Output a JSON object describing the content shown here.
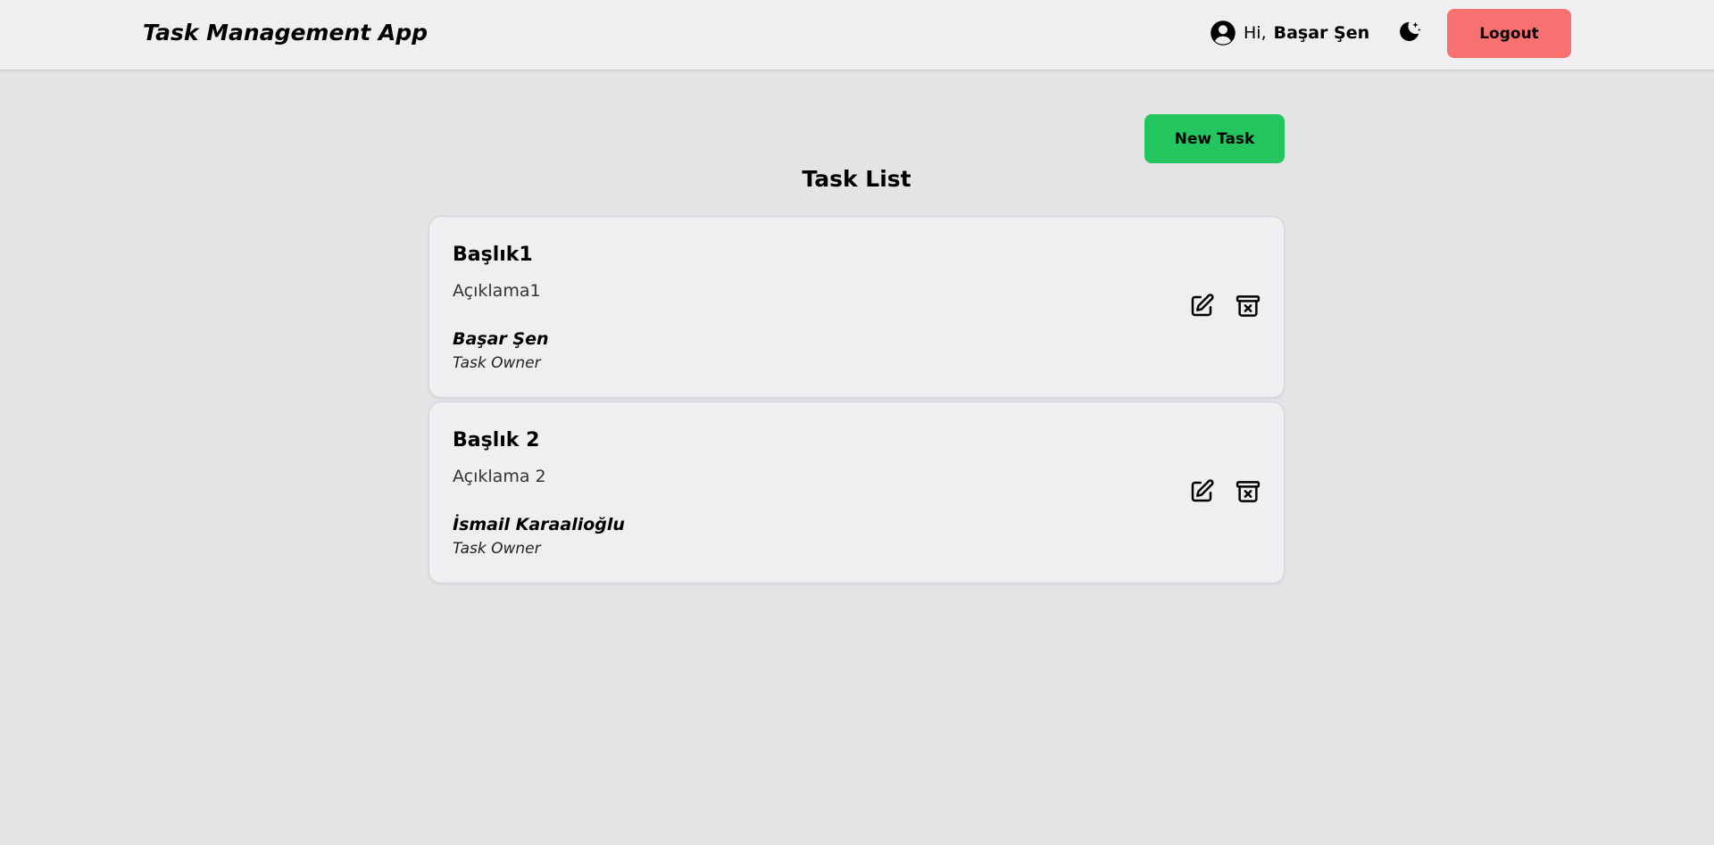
{
  "header": {
    "app_title": "Task Management App",
    "greeting_prefix": "Hi,",
    "user_name": "Başar Şen",
    "theme_toggle_icon": "moon-stars-icon",
    "logout_label": "Logout"
  },
  "main": {
    "new_task_label": "New Task",
    "page_title": "Task List",
    "tasks": [
      {
        "title": "Başlık1",
        "description": "Açıklama1",
        "owner_name": "Başar Şen",
        "owner_role": "Task Owner",
        "edit_icon": "edit-icon",
        "delete_icon": "archive-x-icon"
      },
      {
        "title": "Başlık 2",
        "description": "Açıklama 2",
        "owner_name": "İsmail Karaalioğlu",
        "owner_role": "Task Owner",
        "edit_icon": "edit-icon",
        "delete_icon": "archive-x-icon"
      }
    ]
  },
  "colors": {
    "page_background": "#e4e4e7",
    "card_background": "#efeff1",
    "new_task_button": "#22c55e",
    "logout_button": "#f87171"
  }
}
